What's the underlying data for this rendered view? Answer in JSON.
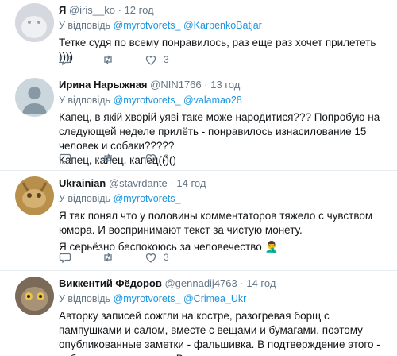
{
  "tweets": [
    {
      "name": "Я",
      "handle": "@iris__ko",
      "dot": "·",
      "time": "12 год",
      "reply_prefix": "У відповідь",
      "mentions": [
        "@myrotvorets_",
        "@KarpenkoBatjar"
      ],
      "text": [
        "Тетке судя по всему понравилось, раз еще раз хочет прилететь ))))"
      ],
      "likes": "3"
    },
    {
      "name": "Ирина Нарыжная",
      "handle": "@NIN1766",
      "dot": "·",
      "time": "13 год",
      "reply_prefix": "У відповідь",
      "mentions": [
        "@myrotvorets_",
        "@valamao28"
      ],
      "text": [
        "Капец, в якій хворій уяві таке може народитися??? Попробую на следующей неделе прилёть - понравилось изнасилование 15 человек и собаки?????",
        "Капец, капец, капец(()()"
      ],
      "likes": "3"
    },
    {
      "name": "Ukrainian",
      "handle": "@stavrdante",
      "dot": "·",
      "time": "14 год",
      "reply_prefix": "У відповідь",
      "mentions": [
        "@myrotvorets_"
      ],
      "text": [
        "Я так понял что у половины комментаторов тяжело с чувством юмора. И воспринимают текст за чистую монету.",
        "Я серьёзно беспокоюсь за человечество 🤦‍♂️"
      ],
      "likes": "3"
    },
    {
      "name": "Виккентий Фёдоров",
      "handle": "@gennadij4763",
      "dot": "·",
      "time": "14 год",
      "reply_prefix": "У відповідь",
      "mentions": [
        "@myrotvorets_",
        "@Crimea_Ukr"
      ],
      "text": [
        "Авторку записей сожгли на костре, разогревая борщ с пампушками и салом, вместе с вещами и бумагами, поэтому опубликованные заметки - фальшивка. В подтверждение этого - собака не насиловала. Вылизывала."
      ],
      "likes": ""
    }
  ],
  "colors": {
    "link": "#1b95e0",
    "muted": "#657786",
    "text": "#14171a",
    "divider": "#e6ecf0"
  },
  "icons": [
    "reply-icon",
    "retweet-icon",
    "like-icon"
  ]
}
